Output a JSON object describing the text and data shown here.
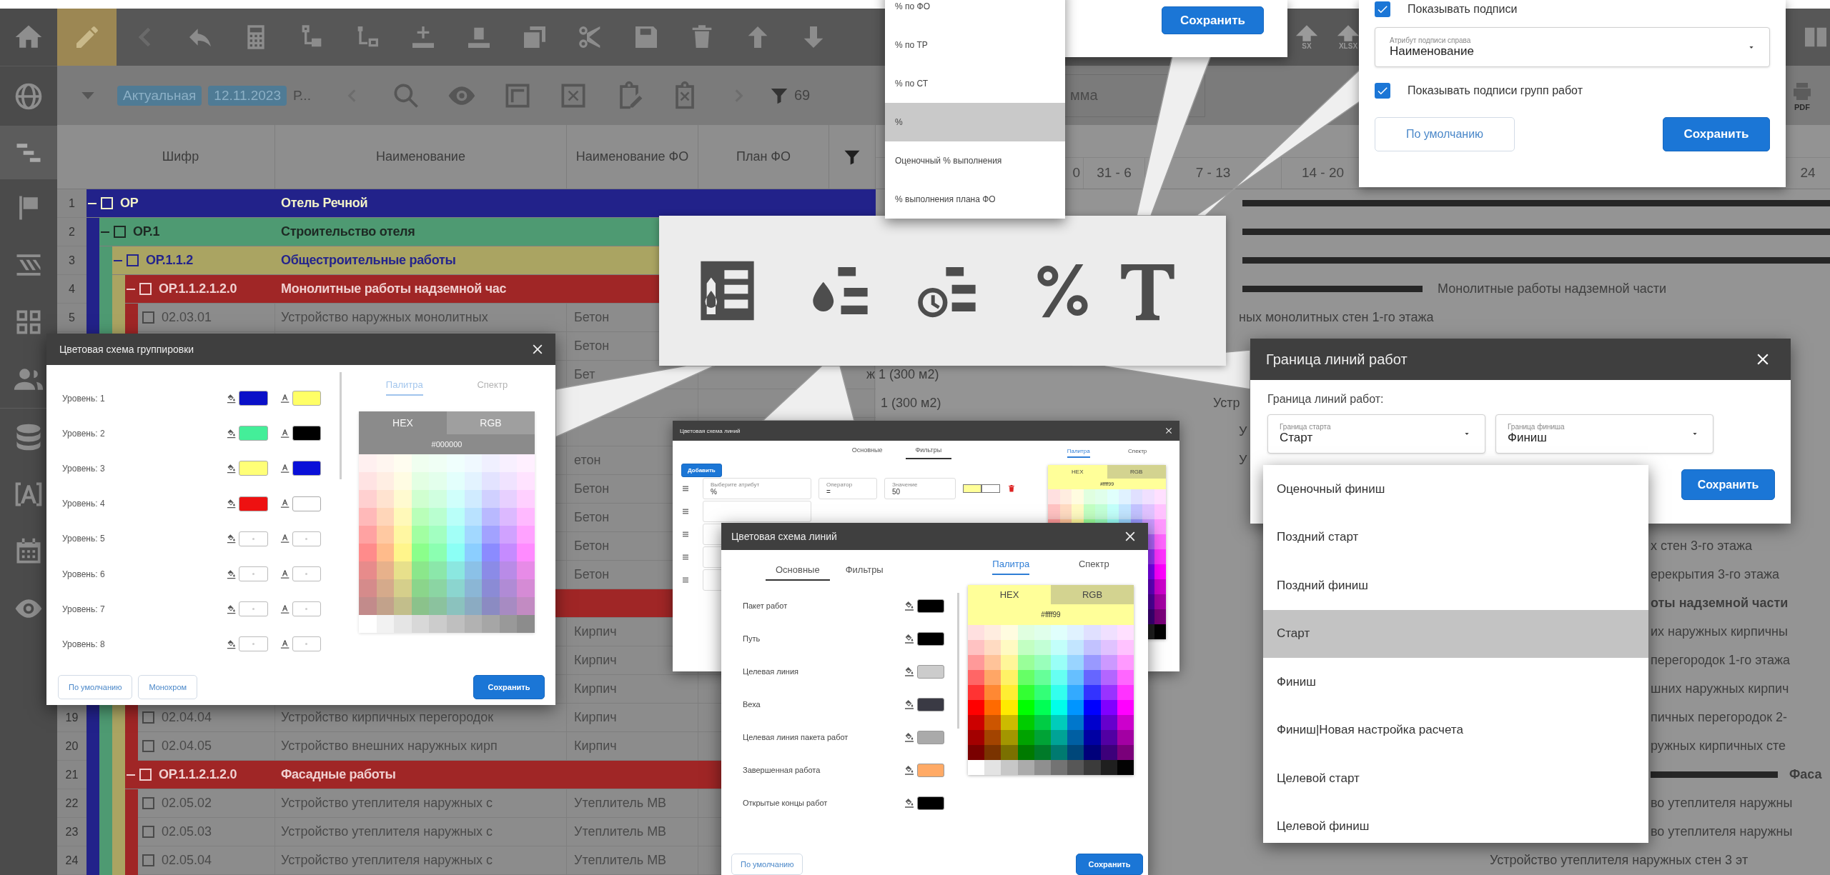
{
  "sidebar": {
    "items": [
      {
        "kind": "home",
        "selected": false
      },
      {
        "kind": "globe",
        "selected": false
      },
      {
        "kind": "gantt",
        "selected": true
      },
      {
        "kind": "flag",
        "selected": false
      },
      {
        "kind": "layers",
        "selected": false
      },
      {
        "kind": "grid",
        "selected": false
      },
      {
        "kind": "users",
        "selected": false
      },
      {
        "kind": "database",
        "selected": false
      },
      {
        "kind": "text",
        "selected": false
      },
      {
        "kind": "calendar",
        "selected": false
      },
      {
        "kind": "eye",
        "selected": false
      }
    ]
  },
  "toolbar": {
    "edit_mode": true,
    "export_labels": [
      "SX",
      "XLSX"
    ]
  },
  "filter_bar": {
    "tags": [
      "Актуальная",
      "12.11.2023"
    ],
    "project": "Р...",
    "filter_count": "69",
    "search_value": "мма",
    "print_label": "PDF"
  },
  "table": {
    "columns": [
      "Шифр",
      "Наименование",
      "Наименование ФО",
      "План ФО"
    ],
    "rows": [
      {
        "number": "1",
        "code": "ОР",
        "name": "Отель Речной",
        "checked": false,
        "color": "#22228a",
        "font": {
          "color": "#f2f2c8"
        },
        "children": [
          {
            "number": "2",
            "code": "ОР.1",
            "name": "Строительство отеля",
            "checked": false,
            "color": "#4e9a72",
            "font": {
              "color": "#1e2a24"
            },
            "children": [
              {
                "number": "3",
                "code": "ОР.1.1.2",
                "name": "Общестроительные работы",
                "checked": false,
                "color": "#aaa462",
                "font": {
                  "color": "#24248c"
                },
                "children": [
                  {
                    "number": "4",
                    "code": "ОР.1.1.2.1.2.0",
                    "name": "Монолитные работы надземной час",
                    "checked": false,
                    "color": "#a02626",
                    "font": {
                      "color": "#f0d0d0"
                    },
                    "gantt": [
                      "Монолитные работы надземной части"
                    ],
                    "children": [
                      {
                        "number": "5",
                        "code": "02.03.01",
                        "name": "Устройство наружных монолитных",
                        "checked": false,
                        "fo": "Бетон",
                        "gantt": [
                          "ных монолитных стен 1-го этажа"
                        ]
                      },
                      {
                        "fo": "Бетон"
                      },
                      {
                        "fo": "Бет",
                        "gantt": [
                          "ж 1 (300 м2)"
                        ]
                      },
                      {
                        "gantt": [
                          "1 (300 м2)",
                          "Устр"
                        ]
                      },
                      {
                        "gantt": [
                          "У"
                        ]
                      },
                      {
                        "fo": "етон",
                        "gantt": [
                          "У"
                        ]
                      },
                      {
                        "fo": "Бетон"
                      },
                      {
                        "fo": "Бетон"
                      },
                      {
                        "fo": "Бетон",
                        "gantt": [
                          "х стен 3-го этажа"
                        ]
                      },
                      {
                        "fo": "Бетон",
                        "gantt": [
                          "ерекрытия 3-го этажа"
                        ]
                      }
                    ]
                  },
                  {
                    "color": "#a02626",
                    "gantt": [
                      "оты надземной части"
                    ],
                    "children": [
                      {
                        "fo": "Кирпич",
                        "gantt": [
                          "их наружных кирпичны"
                        ]
                      },
                      {
                        "fo": "Кирпич",
                        "gantt": [
                          "перегородок 1-го этажа"
                        ]
                      },
                      {
                        "fo": "Кирпич",
                        "gantt": [
                          "шних наружных кирпич"
                        ]
                      },
                      {
                        "number": "19",
                        "code": "02.04.04",
                        "name": "Устройство кирпичных перегородок",
                        "checked": false,
                        "fo": "Кирпич",
                        "gantt": [
                          "пичных перегородок 2-"
                        ]
                      },
                      {
                        "number": "20",
                        "code": "02.04.05",
                        "name": "Устройство внешних наружных кирп",
                        "checked": false,
                        "fo": "Кирпич",
                        "gantt": [
                          "ружных кирпичных сте"
                        ]
                      }
                    ]
                  },
                  {
                    "number": "21",
                    "code": "ОР.1.1.2.1.2.0",
                    "name": "Фасадные работы",
                    "checked": false,
                    "color": "#a02626",
                    "font": {
                      "color": "#f0d0d0"
                    },
                    "gantt": [
                      "Фаса"
                    ],
                    "children": [
                      {
                        "number": "22",
                        "code": "02.05.02",
                        "name": "Устройство утеплителя наружных с",
                        "checked": false,
                        "fo": "Утеплитель МВ",
                        "gantt": [
                          "во утеплителя наружны"
                        ]
                      },
                      {
                        "number": "23",
                        "code": "02.05.03",
                        "name": "Устройство утеплителя наружных с",
                        "checked": false,
                        "fo": "Утеплитель МВ",
                        "gantt": [
                          "во утеплителя наружны"
                        ]
                      },
                      {
                        "number": "24",
                        "code": "02.05.04",
                        "name": "Устройство утеплителя наружных с",
                        "checked": false,
                        "fo": "Утеплитель МВ",
                        "gantt": [
                          "Устройство утеплителя наружных стен 3 эт"
                        ]
                      }
                    ]
                  }
                ]
              }
            ]
          }
        ]
      }
    ]
  },
  "gantt": {
    "weeks": [
      "0",
      "31 - 6",
      "7 - 13",
      "14 - 20",
      "24"
    ]
  },
  "percent_popup": {
    "options": [
      {
        "label": "% по ФО",
        "selected": false
      },
      {
        "label": "% по ТР",
        "selected": false
      },
      {
        "label": "% по СТ",
        "selected": false
      },
      {
        "label": "%",
        "selected": true
      },
      {
        "label": "Оценочный % выполнения",
        "selected": false
      },
      {
        "label": "% выполнения плана ФО",
        "selected": false
      }
    ],
    "save_button": "Сохранить"
  },
  "label_popup": {
    "show_labels": {
      "label": "Показывать подписи",
      "checked": true
    },
    "right_label_field": {
      "label": "Атрибут подписи справа",
      "value": "Наименование"
    },
    "show_group_labels": {
      "label": "Показывать подписи групп работ",
      "checked": true
    },
    "buttons": [
      "По умолчанию",
      "Сохранить"
    ]
  },
  "grouping_dialog": {
    "title": "Цветовая схема группировки",
    "levels": [
      {
        "label": "Уровень: 1",
        "fill": {
          "color": "#0a10c8"
        },
        "font": {
          "color": "#ffff66"
        }
      },
      {
        "label": "Уровень: 2",
        "fill": {
          "color": "#44ee99"
        },
        "font": {
          "color": "#000000"
        }
      },
      {
        "label": "Уровень: 3",
        "fill": {
          "color": "#ffff77"
        },
        "font": {
          "color": "#0a10d8"
        }
      },
      {
        "label": "Уровень: 4",
        "fill": {
          "color": "#ee1111"
        },
        "font": {
          "color": "#ffffff"
        }
      },
      {
        "label": "Уровень: 5"
      },
      {
        "label": "Уровень: 6"
      },
      {
        "label": "Уровень: 7"
      },
      {
        "label": "Уровень: 8"
      }
    ],
    "picker_tabs": [
      {
        "label": "Палитра",
        "selected": true
      },
      {
        "label": "Спектр",
        "selected": false
      }
    ],
    "format_tabs": [
      {
        "label": "HEX",
        "selected": true
      },
      {
        "label": "RGB",
        "selected": false
      }
    ],
    "hex_value": "#000000",
    "picker_disabled": true,
    "buttons": [
      "По умолчанию",
      "Монохром",
      "Сохранить"
    ]
  },
  "line_filters_dialog": {
    "title": "Цветовая схема линий",
    "tabs": [
      {
        "label": "Основные",
        "selected": false
      },
      {
        "label": "Фильтры",
        "selected": true
      }
    ],
    "picker_tabs": [
      {
        "label": "Палитра",
        "selected": true
      },
      {
        "label": "Спектр",
        "selected": false
      }
    ],
    "add_button": "Добавить",
    "filter": {
      "attribute_label": "Выберите атрибут",
      "attribute": "%",
      "operator_label": "Оператор",
      "operator": "=",
      "value_label": "Значение",
      "value": "50",
      "color": "#ffff99"
    },
    "format_tabs": [
      {
        "label": "HEX",
        "selected": true
      },
      {
        "label": "RGB",
        "selected": false
      }
    ],
    "hex_value": "#ffff99"
  },
  "line_colors_dialog": {
    "title": "Цветовая схема линий",
    "tabs": [
      {
        "label": "Основные",
        "selected": true
      },
      {
        "label": "Фильтры",
        "selected": false
      }
    ],
    "picker_tabs": [
      {
        "label": "Палитра",
        "selected": true
      },
      {
        "label": "Спектр",
        "selected": false
      }
    ],
    "items": [
      {
        "label": "Пакет работ",
        "color": "#000000"
      },
      {
        "label": "Путь",
        "color": "#000000"
      },
      {
        "label": "Целевая линия",
        "color": "#cccccc"
      },
      {
        "label": "Веха",
        "color": "#3a3a44"
      },
      {
        "label": "Целевая линия пакета работ",
        "color": "#aaaaaa"
      },
      {
        "label": "Завершенная работа",
        "color": "#ffaa66"
      },
      {
        "label": "Открытые концы работ",
        "color": "#000000"
      }
    ],
    "format_tabs": [
      {
        "label": "HEX",
        "selected": true
      },
      {
        "label": "RGB",
        "selected": false
      }
    ],
    "hex_value": "#ffff99",
    "buttons": [
      "По умолчанию",
      "Сохранить"
    ]
  },
  "bounds_dialog": {
    "title": "Граница линий работ",
    "label": "Граница линий работ:",
    "start_field": {
      "label": "Граница старта",
      "value": "Старт"
    },
    "finish_field": {
      "label": "Граница финиша",
      "value": "Финиш"
    },
    "save_button": "Сохранить",
    "options": [
      {
        "label": "Оценочный финиш",
        "selected": false
      },
      {
        "label": "Поздний старт",
        "selected": false
      },
      {
        "label": "Поздний финиш",
        "selected": false
      },
      {
        "label": "Старт",
        "selected": true
      },
      {
        "label": "Финиш",
        "selected": false
      },
      {
        "label": "Финиш|Новая настройка расчета",
        "selected": false
      },
      {
        "label": "Целевой старт",
        "selected": false
      },
      {
        "label": "Целевой финиш",
        "selected": false
      }
    ]
  }
}
